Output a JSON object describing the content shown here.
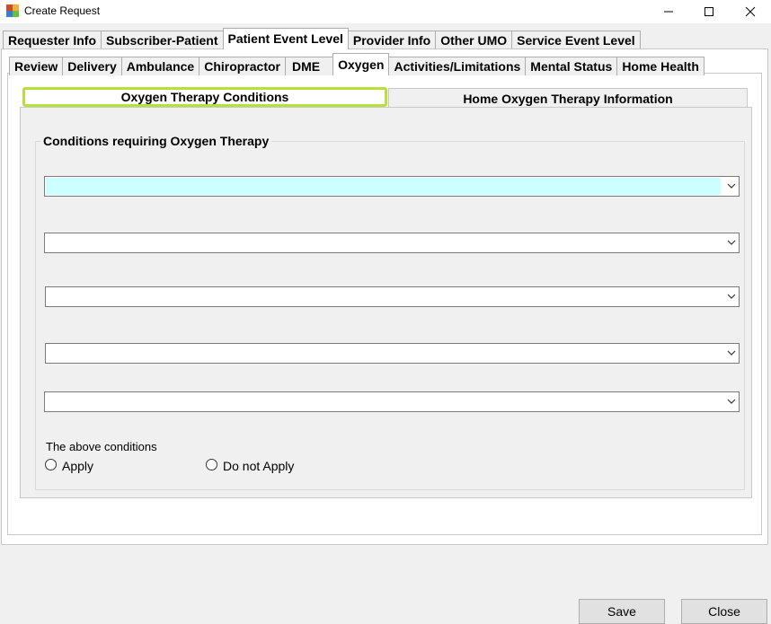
{
  "window": {
    "title": "Create Request"
  },
  "main_tabs": [
    {
      "label": "Requester Info"
    },
    {
      "label": "Subscriber-Patient"
    },
    {
      "label": "Patient Event Level",
      "active": true
    },
    {
      "label": "Provider Info"
    },
    {
      "label": "Other UMO"
    },
    {
      "label": "Service Event Level"
    }
  ],
  "sub_tabs": [
    {
      "label": "Review"
    },
    {
      "label": "Delivery"
    },
    {
      "label": "Ambulance"
    },
    {
      "label": "Chiropractor"
    },
    {
      "label": "DME"
    },
    {
      "label": "Oxygen",
      "active": true
    },
    {
      "label": "Activities/Limitations"
    },
    {
      "label": "Mental Status"
    },
    {
      "label": "Home Health"
    }
  ],
  "oxygen_tabs": [
    {
      "label": "Oxygen Therapy Conditions",
      "active": true
    },
    {
      "label": "Home Oxygen Therapy Information"
    }
  ],
  "conditions_group": {
    "title": "Conditions requiring Oxygen Therapy",
    "dropdowns": [
      {
        "value": "",
        "highlight_color": "#ccffff"
      },
      {
        "value": ""
      },
      {
        "value": ""
      },
      {
        "value": ""
      },
      {
        "value": ""
      }
    ],
    "above_label": "The above conditions",
    "options": [
      {
        "label": "Apply",
        "checked": false
      },
      {
        "label": "Do not Apply",
        "checked": false
      }
    ]
  },
  "buttons": {
    "save": "Save",
    "close": "Close"
  },
  "colors": {
    "active_subtab_border": "#b9e03a",
    "focused_field": "#ccffff"
  }
}
